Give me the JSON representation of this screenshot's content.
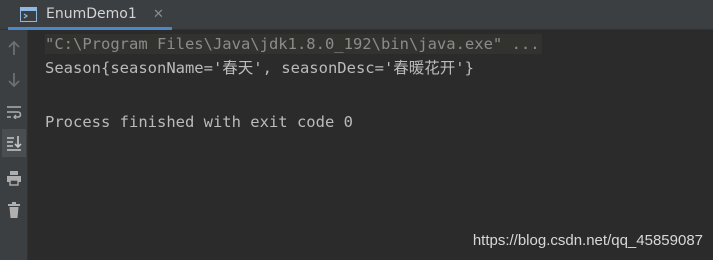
{
  "tab": {
    "label": "EnumDemo1",
    "close": "✕"
  },
  "toolbar": {
    "items": [
      "arrow-up-icon",
      "arrow-down-icon",
      "soft-wrap-icon",
      "scroll-to-end-icon",
      "print-icon",
      "trash-icon"
    ]
  },
  "console": {
    "command": "\"C:\\Program Files\\Java\\jdk1.8.0_192\\bin\\java.exe\" ...",
    "output": "Season{seasonName='春天', seasonDesc='春暖花开'}",
    "exit": "Process finished with exit code 0"
  },
  "watermark": "https://blog.csdn.net/qq_45859087",
  "colors": {
    "background": "#2b2b2b",
    "panel": "#3c3f41",
    "accent": "#4a88c7",
    "text": "#bbbbbb"
  }
}
